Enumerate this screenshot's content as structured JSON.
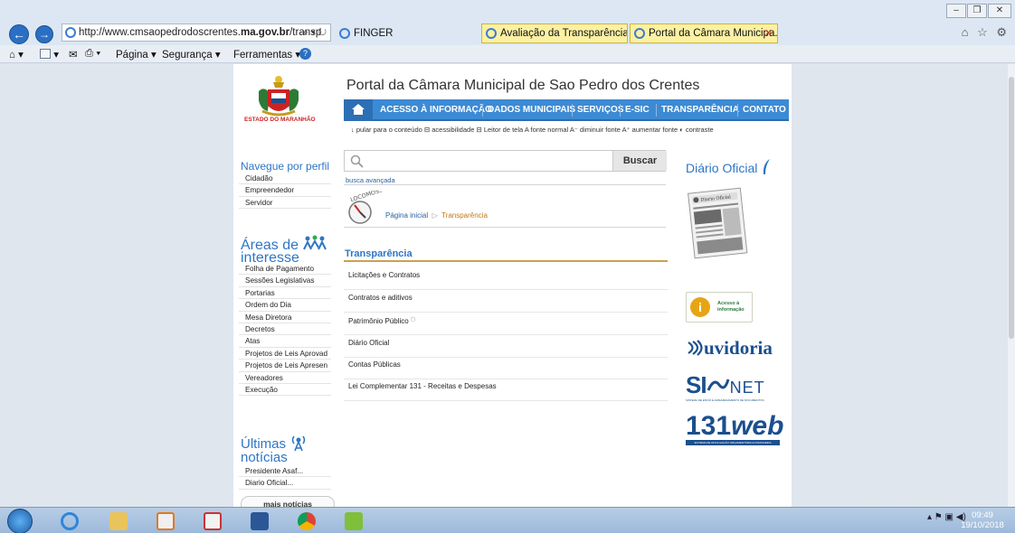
{
  "browser": {
    "url_prefix": "http://www.cmsaopedrodoscrentes.",
    "url_domain": "ma.gov.br",
    "url_suffix": "/transp",
    "address_controls": "⌕ ▾ ↻",
    "favorite": "FINGER",
    "tabs": [
      {
        "title": "Avaliação da Transparência do...",
        "active": false
      },
      {
        "title": "Portal da Câmara Municipa...",
        "active": true,
        "close": "✕"
      }
    ],
    "right_icons": "⌂ ☆ ⚙",
    "window_buttons": {
      "minimize": "–",
      "restore": "❐",
      "close": "✕"
    },
    "command_bar": {
      "items": [
        "Página ▾",
        "Segurança ▾",
        "Ferramentas ▾"
      ],
      "help_icon": "?"
    }
  },
  "site": {
    "state_label": "ESTADO DO MARANHÃO",
    "title": "Portal da Câmara Municipal de Sao Pedro dos Crentes",
    "menu": [
      "ACESSO À INFORMAÇÃO",
      "DADOS MUNICIPAIS",
      "SERVIÇOS",
      "E-SIC",
      "TRANSPARÊNCIA",
      "CONTATO"
    ],
    "accessibility_bar": "↓ pular para o conteúdo ⊟ acessibilidade ⊟ Leitor de tela A fonte normal A⁻ diminuir fonte A⁺ aumentar fonte ◐ contraste",
    "left": {
      "profile_heading": "Navegue por perfil",
      "profile_items": [
        "Cidadão",
        "Empreendedor",
        "Servidor"
      ],
      "areas_heading_1": "Áreas de",
      "areas_heading_2": "interesse",
      "areas_items": [
        "Folha de Pagamento",
        "Sessões Legislativas",
        "Portarias",
        "Ordem do Dia",
        "Mesa Diretora",
        "Decretos",
        "Atas",
        "Projetos de Leis Aprovad",
        "Projetos de Leis Apresen",
        "Vereadores",
        "Execução"
      ],
      "news_heading_1": "Últimas",
      "news_heading_2": "notícias",
      "news_items": [
        "Presidente Asaf...",
        "Diario Oficial..."
      ],
      "more_news": "mais notícias"
    },
    "center": {
      "search_button": "Buscar",
      "advanced_search": "busca avançada",
      "locomoss": "LOCOMOSS",
      "breadcrumb": {
        "home": "Página inicial",
        "current": "Transparência"
      },
      "section_title": "Transparência",
      "links": [
        "Licitações e Contratos",
        "Contratos e aditivos",
        "Patrimônio Público",
        "Diário Oficial",
        "Contas Públicas",
        "Lei Complementar 131 - Receitas e Despesas"
      ]
    },
    "right": {
      "diario_heading": "Diário Oficial",
      "diario_thumb_label": "Diario Oficial",
      "acesso_icon": "i",
      "acesso_line_1": "Acesso à",
      "acesso_line_2": "informação",
      "ouvidoria": "uvidoria",
      "siofnet_main": "SI",
      "siofnet_net": "NET",
      "siofnet_sub": "SISTEMA DE ENVIO E ARMAZENAMENTO DE DOCUMENTOS",
      "web131_main": "131",
      "web131_web": "web",
      "web131_sub": "SISTEMA DE DIVULGAÇÃO ORÇAMENTÁRIA E FINANCEIRA"
    }
  },
  "taskbar": {
    "time": "09:49",
    "date": "19/10/2018",
    "tray_icons": "▴ ⚑ ▣ ◀)"
  },
  "colors": {
    "accent": "#2e76c5",
    "menu": "#3d8ad4",
    "tab_highlight": "#fbf1a3",
    "gold_line": "#c9a24a"
  }
}
